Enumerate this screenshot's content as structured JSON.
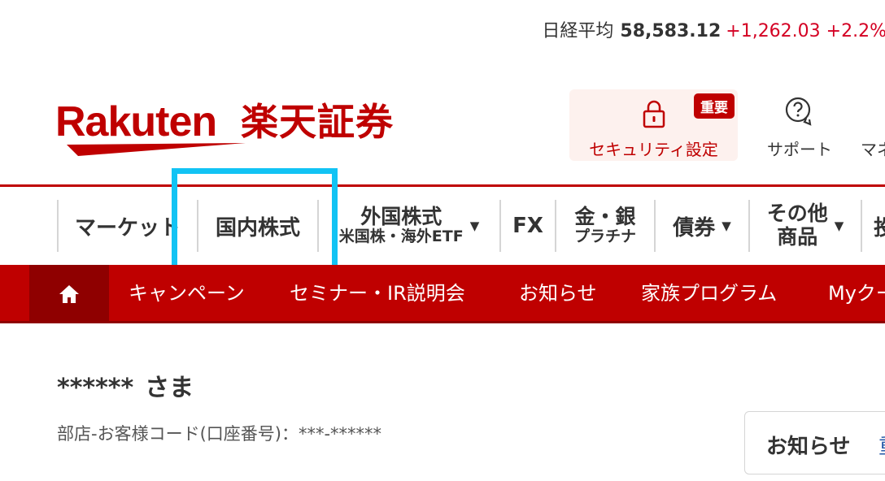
{
  "ticker": {
    "name": "日経平均",
    "value": "58,583.12",
    "change": "+1,262.03",
    "pct": "+2.2%"
  },
  "logo": {
    "wordmark": "Rakuten",
    "brand": "楽天証券"
  },
  "header": {
    "security_badge": "重要",
    "security_label": "セキュリティ設定",
    "support_label": "サポート",
    "more_label": "マネ"
  },
  "main_nav": {
    "market": "マーケット",
    "domestic": "国内株式",
    "foreign_l1": "外国株式",
    "foreign_l2": "米国株・海外ETF",
    "fx": "FX",
    "gold_l1": "金・銀",
    "gold_l2": "プラチナ",
    "bonds": "債券",
    "other_l1": "その他",
    "other_l2": "商品",
    "next": "投"
  },
  "sub_nav": {
    "campaign": "キャンペーン",
    "seminar": "セミナー・IR説明会",
    "news": "お知らせ",
    "family": "家族プログラム",
    "mycoupon": "Myクー"
  },
  "content": {
    "user_name": "******",
    "honorific": "さま",
    "customer_code": "部店-お客様コード(口座番号)：***-******",
    "news_title": "お知らせ",
    "news_more": "重"
  },
  "colors": {
    "brand_red": "#bf0000",
    "dark_red": "#8f0000",
    "highlight": "#12c3f4",
    "ticker_up": "#d40023"
  }
}
